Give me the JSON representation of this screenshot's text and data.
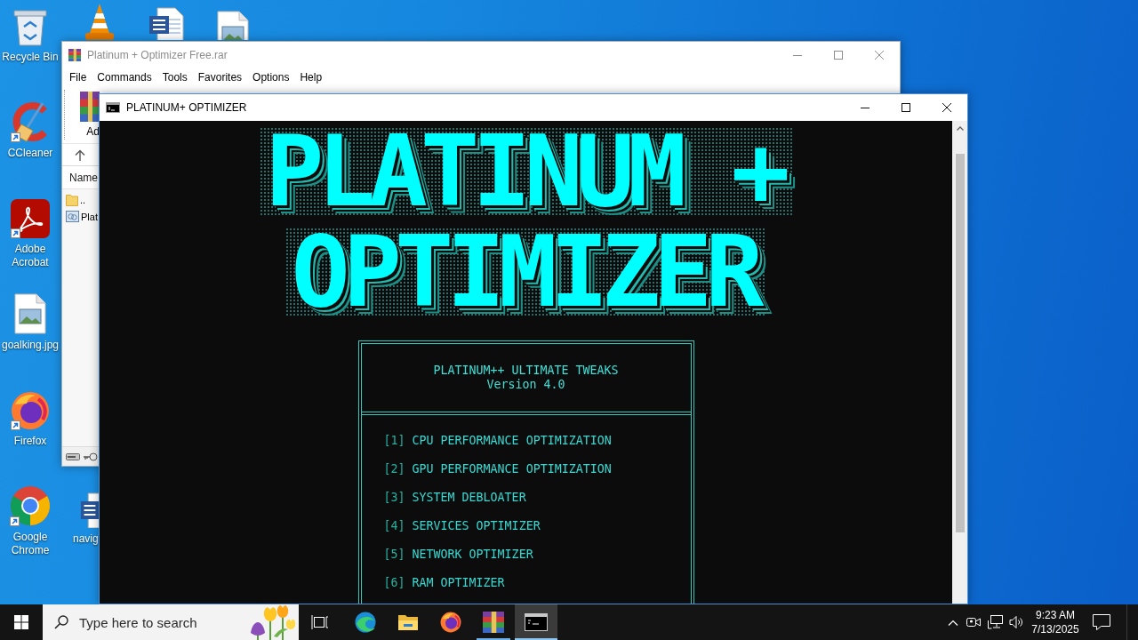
{
  "desktop": {
    "icons": [
      {
        "kind": "recycle-bin",
        "label": "Recycle Bin",
        "shortcut": false
      },
      {
        "kind": "ccleaner",
        "label": "CCleaner",
        "shortcut": true
      },
      {
        "kind": "acrobat",
        "label": "Adobe Acrobat",
        "shortcut": true
      },
      {
        "kind": "image-file",
        "label": "goalking.jpg",
        "shortcut": false
      },
      {
        "kind": "firefox",
        "label": "Firefox",
        "shortcut": true
      },
      {
        "kind": "chrome",
        "label": "Google Chrome",
        "shortcut": true
      },
      {
        "kind": "vlc"
      },
      {
        "kind": "word"
      },
      {
        "kind": "image-file"
      },
      {
        "kind": "word",
        "label": "navig",
        "shortcut": false
      }
    ]
  },
  "archive_window": {
    "title": "Platinum + Optimizer Free.rar",
    "active": false,
    "menu": [
      "File",
      "Commands",
      "Tools",
      "Favorites",
      "Options",
      "Help"
    ],
    "toolbar": [
      {
        "label": "Ad"
      }
    ],
    "columns": [
      "Name"
    ],
    "files": [
      {
        "kind": "folder",
        "name": ".."
      },
      {
        "kind": "archive",
        "name": "Plat"
      }
    ]
  },
  "console_window": {
    "title": "PLATINUM+ OPTIMIZER",
    "active": true,
    "banner": [
      "PLATINUM +",
      "OPTIMIZER"
    ],
    "header": {
      "title": "PLATINUM++ ULTIMATE TWEAKS",
      "version": "Version 4.0"
    },
    "options": [
      {
        "key": "[1]",
        "label": "CPU PERFORMANCE OPTIMIZATION"
      },
      {
        "key": "[2]",
        "label": "GPU PERFORMANCE OPTIMIZATION"
      },
      {
        "key": "[3]",
        "label": "SYSTEM DEBLOATER"
      },
      {
        "key": "[4]",
        "label": "SERVICES OPTIMIZER"
      },
      {
        "key": "[5]",
        "label": "NETWORK OPTIMIZER"
      },
      {
        "key": "[6]",
        "label": "RAM OPTIMIZER"
      }
    ]
  },
  "taskbar": {
    "search": {
      "placeholder": "Type here to search"
    },
    "apps": [
      {
        "kind": "edge",
        "running": false,
        "selected": false
      },
      {
        "kind": "explorer",
        "running": false,
        "selected": false
      },
      {
        "kind": "firefox",
        "running": false,
        "selected": false
      },
      {
        "kind": "winrar",
        "running": true,
        "selected": false
      },
      {
        "kind": "terminal",
        "running": true,
        "selected": true
      }
    ],
    "clock": {
      "time": "9:23 AM",
      "date": "7/13/2025"
    }
  }
}
